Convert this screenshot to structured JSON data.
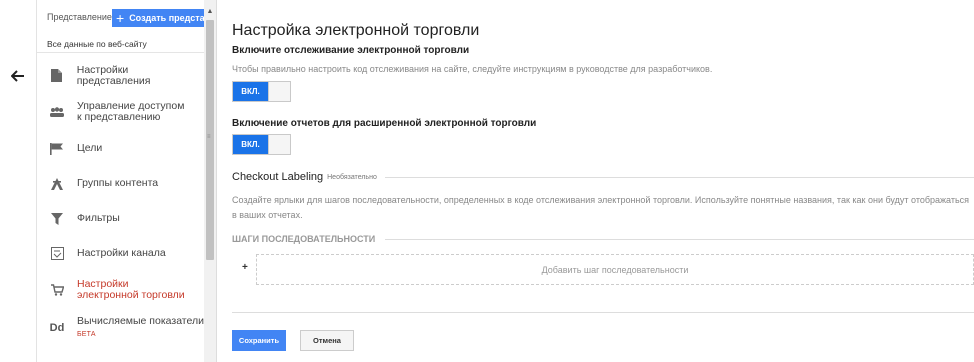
{
  "nav": {
    "view_label": "Представление",
    "create_view_label": "Создать представ",
    "current_view": "Все данные по веб-сайту",
    "items": [
      {
        "label": "Настройки представления",
        "icon": "document-icon"
      },
      {
        "label": "Управление доступом к представлению",
        "icon": "users-icon"
      },
      {
        "label": "Цели",
        "icon": "flag-icon"
      },
      {
        "label": "Группы контента",
        "icon": "content-group-icon"
      },
      {
        "label": "Фильтры",
        "icon": "filter-icon"
      },
      {
        "label": "Настройки канала",
        "icon": "channel-settings-icon"
      },
      {
        "label": "Настройки электронной торговли",
        "icon": "cart-icon",
        "active": true
      },
      {
        "label": "Вычисляемые показатели",
        "icon": "calculated-metrics-icon",
        "badge": "БЕТА",
        "icon_text": "Dd"
      }
    ]
  },
  "main": {
    "title": "Настройка электронной торговли",
    "tracking_title": "Включите отслеживание электронной торговли",
    "tracking_desc": "Чтобы правильно настроить код отслеживания на сайте, следуйте инструкциям в руководстве для разработчиков.",
    "toggle_on_label": "ВКЛ.",
    "enhanced_title": "Включение отчетов для расширенной электронной торговли",
    "checkout_title": "Checkout Labeling",
    "checkout_optional": "Необязательно",
    "checkout_desc": "Создайте ярлыки для шагов последовательности, определенных в коде отслеживания электронной торговли. Используйте понятные названия, так как они будут отображаться в ваших отчетах.",
    "steps_title": "ШАГИ ПОСЛЕДОВАТЕЛЬНОСТИ",
    "add_step_plus": "+",
    "add_step_label": "Добавить шаг последовательности",
    "save_label": "Сохранить",
    "cancel_label": "Отмена"
  },
  "colors": {
    "accent": "#4285f4",
    "toggle_on": "#1a73e8",
    "active_nav": "#c53929"
  }
}
